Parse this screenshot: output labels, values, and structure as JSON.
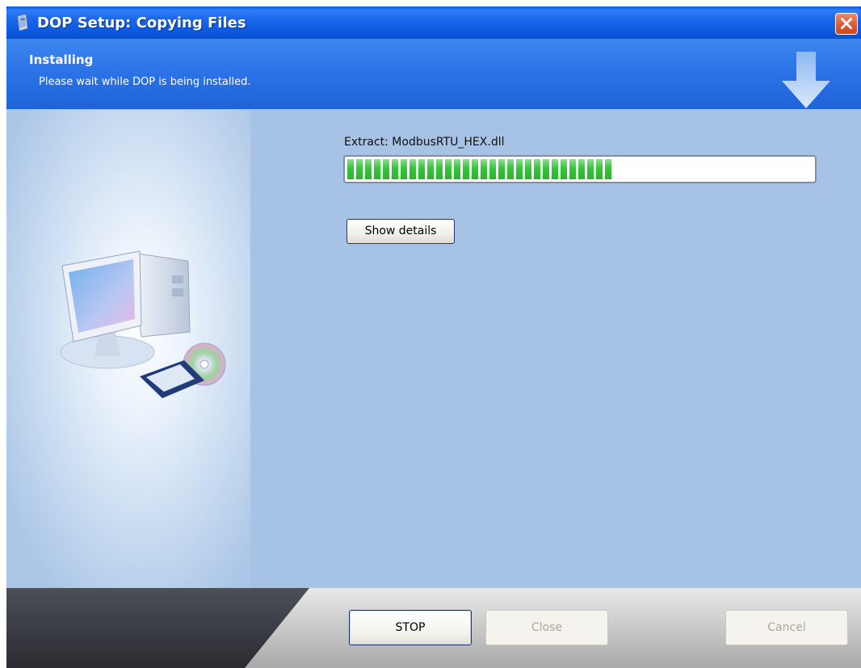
{
  "window": {
    "title": "DOP Setup: Copying Files"
  },
  "header": {
    "title": "Installing",
    "subtitle": "Please wait while DOP is being installed."
  },
  "main": {
    "status_text": "Extract: ModbusRTU_HEX.dll",
    "progress_fraction": 0.57,
    "show_details_label": "Show details"
  },
  "footer": {
    "stop_label": "STOP",
    "close_label": "Close",
    "cancel_label": "Cancel"
  },
  "colors": {
    "titlebar_blue": "#0054e3",
    "header_blue": "#2a72e6",
    "content_bg": "#a6c2e4",
    "progress_green": "#35c43a",
    "close_red": "#e35d36"
  },
  "icons": {
    "app": "installer-app-icon",
    "window_close": "close-icon",
    "header": "down-arrow-icon",
    "illustration": "computer-with-cd-icon"
  }
}
